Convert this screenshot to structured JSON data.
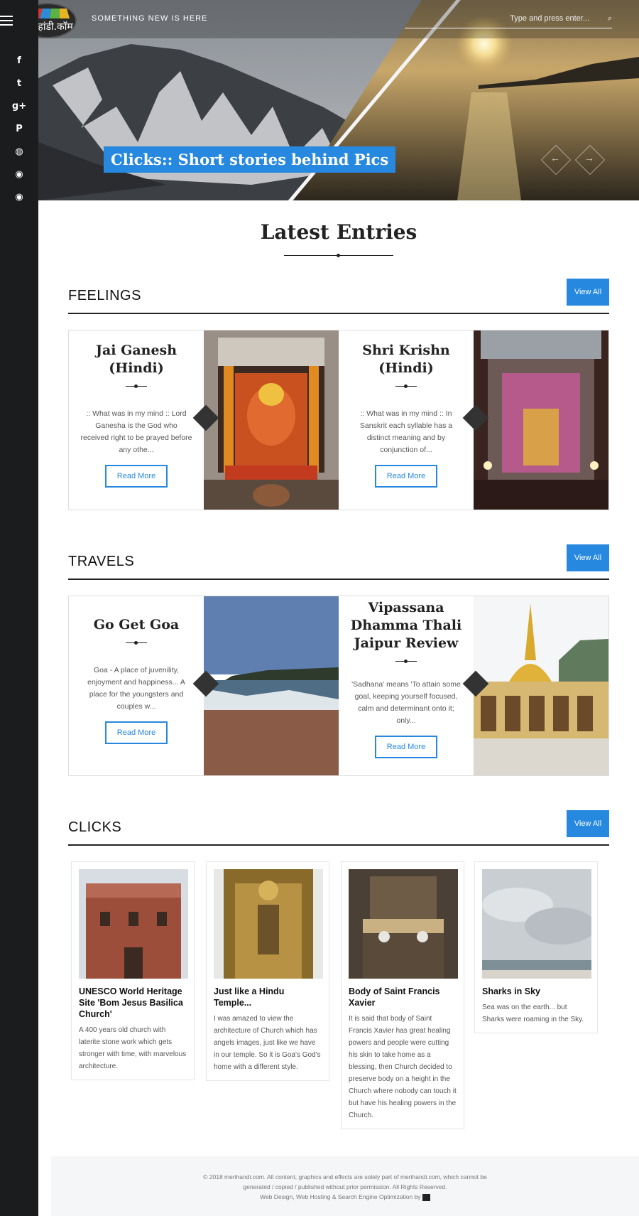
{
  "header": {
    "logo_text": "मेरी हांडी.कॉम",
    "tagline": "SOMETHING NEW IS HERE",
    "search_placeholder": "Type and press enter...",
    "hero_title": "Clicks:: Short stories behind Pics"
  },
  "sidebar": {
    "social": [
      {
        "icon": "facebook-icon",
        "glyph": "f"
      },
      {
        "icon": "twitter-icon",
        "glyph": "t"
      },
      {
        "icon": "google-plus-icon",
        "glyph": "g+"
      },
      {
        "icon": "pinterest-icon",
        "glyph": "P"
      },
      {
        "icon": "globe-icon",
        "glyph": "◍"
      },
      {
        "icon": "rss-icon",
        "glyph": "◉"
      },
      {
        "icon": "rss-icon",
        "glyph": "◉"
      }
    ]
  },
  "latest_title": "Latest Entries",
  "sections": {
    "feelings": {
      "title": "FEELINGS",
      "view_all": "View All",
      "cards": [
        {
          "title": "Jai Ganesh (Hindi)",
          "excerpt": ":: What was in my mind :: Lord Ganesha is the God who received right to be prayed before any othe...",
          "read_more": "Read More"
        },
        {
          "title": "Shri Krishn (Hindi)",
          "excerpt": ":: What was in my mind :: In Sanskrit each syllable has a distinct meaning and by conjunction of...",
          "read_more": "Read More"
        }
      ]
    },
    "travels": {
      "title": "TRAVELS",
      "view_all": "View All",
      "cards": [
        {
          "title": "Go Get Goa",
          "excerpt": "Goa - A place of juvenility, enjoyment and happiness... A place for the youngsters and couples w...",
          "read_more": "Read More"
        },
        {
          "title": "Vipassana Dhamma Thali Jaipur Review",
          "excerpt": "'Sadhana' means 'To attain some goal, keeping yourself focused, calm and determinant onto it; only...",
          "read_more": "Read More"
        }
      ]
    },
    "clicks": {
      "title": "CLICKS",
      "view_all": "View All",
      "items": [
        {
          "title": "UNESCO World Heritage Site 'Bom Jesus Basilica Church'",
          "text": "A 400 years old church with laterite stone work which gets stronger with time, with marvelous architecture."
        },
        {
          "title": "Just like a Hindu Temple...",
          "text": "I was amazed to view the architecture of Church which has angels images, just like we have in our temple. So it is Goa's God's home with a different style."
        },
        {
          "title": "Body of Saint Francis Xavier",
          "text": "It is said that body of Saint Francis Xavier has great healing powers and people were cutting his skin to take home as a blessing, then Church decided to preserve body on a height in the Church where nobody can touch it but have his healing powers in the Church."
        },
        {
          "title": "Sharks in Sky",
          "text": "Sea was on the earth... but Sharks were roaming in the Sky."
        }
      ]
    }
  },
  "footer": {
    "line1": "© 2018 merihandi.com. All content, graphics and effects are solely part of merihandi.com, which cannot be",
    "line2": "generated / copied / published without prior permission. All Rights Reserved.",
    "line3": "Web Design, Web Hosting & Search Engine Optimization by"
  },
  "colors": {
    "accent": "#2688de",
    "sidebar": "#1b1c1e"
  }
}
